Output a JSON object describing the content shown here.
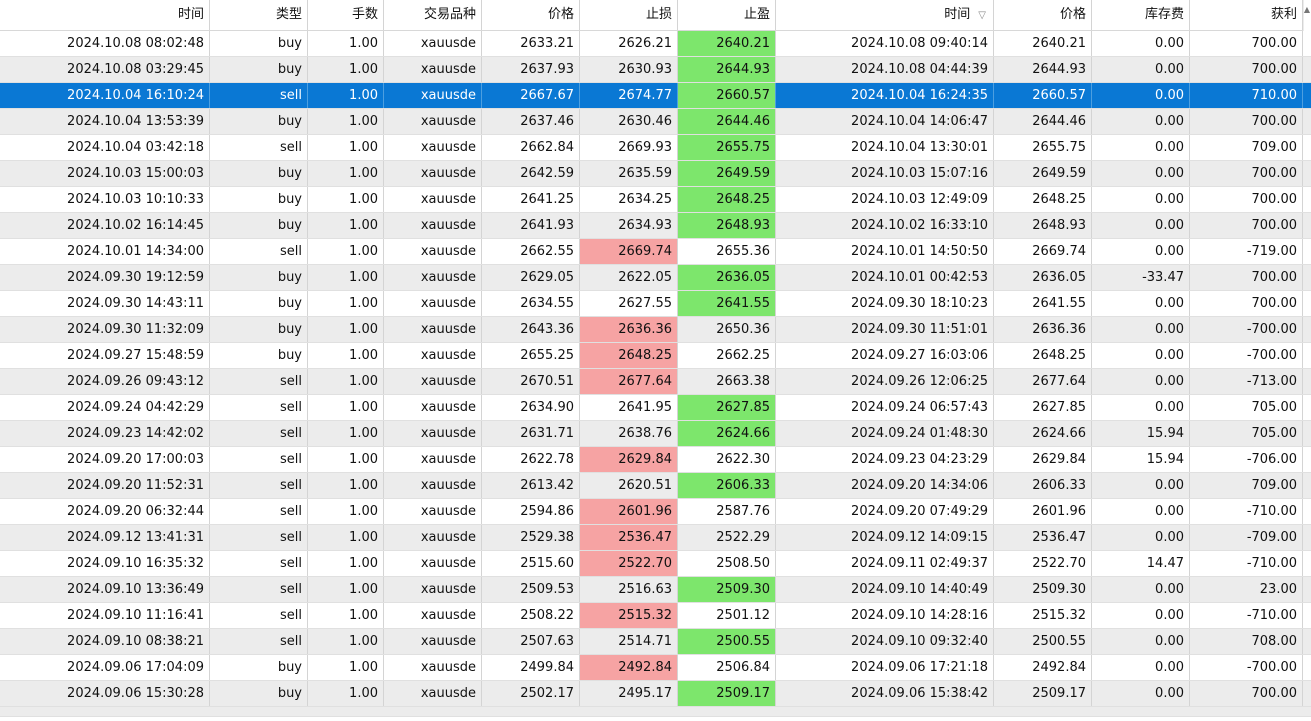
{
  "columns": [
    {
      "label": "时间"
    },
    {
      "label": "类型"
    },
    {
      "label": "手数"
    },
    {
      "label": "交易品种"
    },
    {
      "label": "价格"
    },
    {
      "label": "止损"
    },
    {
      "label": "止盈"
    },
    {
      "label": "时间",
      "sort_icon": "sort-descending-icon",
      "sort_glyph": "▽"
    },
    {
      "label": "价格"
    },
    {
      "label": "库存费"
    },
    {
      "label": "获利"
    }
  ],
  "colors": {
    "selected": "#0a78d4",
    "take_profit_hit": "#7de66c",
    "stop_loss_hit": "#f6a3a3",
    "alt_row": "#ececec"
  },
  "rows": [
    {
      "open_time": "2024.10.08 08:02:48",
      "type": "buy",
      "volume": "1.00",
      "symbol": "xauusde",
      "open_price": "2633.21",
      "sl": "2626.21",
      "tp": "2640.21",
      "close_time": "2024.10.08 09:40:14",
      "close_price": "2640.21",
      "swap": "0.00",
      "profit": "700.00",
      "hit": "tp"
    },
    {
      "open_time": "2024.10.08 03:29:45",
      "type": "buy",
      "volume": "1.00",
      "symbol": "xauusde",
      "open_price": "2637.93",
      "sl": "2630.93",
      "tp": "2644.93",
      "close_time": "2024.10.08 04:44:39",
      "close_price": "2644.93",
      "swap": "0.00",
      "profit": "700.00",
      "hit": "tp"
    },
    {
      "open_time": "2024.10.04 16:10:24",
      "type": "sell",
      "volume": "1.00",
      "symbol": "xauusde",
      "open_price": "2667.67",
      "sl": "2674.77",
      "tp": "2660.57",
      "close_time": "2024.10.04 16:24:35",
      "close_price": "2660.57",
      "swap": "0.00",
      "profit": "710.00",
      "hit": "tp",
      "selected": true
    },
    {
      "open_time": "2024.10.04 13:53:39",
      "type": "buy",
      "volume": "1.00",
      "symbol": "xauusde",
      "open_price": "2637.46",
      "sl": "2630.46",
      "tp": "2644.46",
      "close_time": "2024.10.04 14:06:47",
      "close_price": "2644.46",
      "swap": "0.00",
      "profit": "700.00",
      "hit": "tp"
    },
    {
      "open_time": "2024.10.04 03:42:18",
      "type": "sell",
      "volume": "1.00",
      "symbol": "xauusde",
      "open_price": "2662.84",
      "sl": "2669.93",
      "tp": "2655.75",
      "close_time": "2024.10.04 13:30:01",
      "close_price": "2655.75",
      "swap": "0.00",
      "profit": "709.00",
      "hit": "tp"
    },
    {
      "open_time": "2024.10.03 15:00:03",
      "type": "buy",
      "volume": "1.00",
      "symbol": "xauusde",
      "open_price": "2642.59",
      "sl": "2635.59",
      "tp": "2649.59",
      "close_time": "2024.10.03 15:07:16",
      "close_price": "2649.59",
      "swap": "0.00",
      "profit": "700.00",
      "hit": "tp"
    },
    {
      "open_time": "2024.10.03 10:10:33",
      "type": "buy",
      "volume": "1.00",
      "symbol": "xauusde",
      "open_price": "2641.25",
      "sl": "2634.25",
      "tp": "2648.25",
      "close_time": "2024.10.03 12:49:09",
      "close_price": "2648.25",
      "swap": "0.00",
      "profit": "700.00",
      "hit": "tp"
    },
    {
      "open_time": "2024.10.02 16:14:45",
      "type": "buy",
      "volume": "1.00",
      "symbol": "xauusde",
      "open_price": "2641.93",
      "sl": "2634.93",
      "tp": "2648.93",
      "close_time": "2024.10.02 16:33:10",
      "close_price": "2648.93",
      "swap": "0.00",
      "profit": "700.00",
      "hit": "tp"
    },
    {
      "open_time": "2024.10.01 14:34:00",
      "type": "sell",
      "volume": "1.00",
      "symbol": "xauusde",
      "open_price": "2662.55",
      "sl": "2669.74",
      "tp": "2655.36",
      "close_time": "2024.10.01 14:50:50",
      "close_price": "2669.74",
      "swap": "0.00",
      "profit": "-719.00",
      "hit": "sl"
    },
    {
      "open_time": "2024.09.30 19:12:59",
      "type": "buy",
      "volume": "1.00",
      "symbol": "xauusde",
      "open_price": "2629.05",
      "sl": "2622.05",
      "tp": "2636.05",
      "close_time": "2024.10.01 00:42:53",
      "close_price": "2636.05",
      "swap": "-33.47",
      "profit": "700.00",
      "hit": "tp"
    },
    {
      "open_time": "2024.09.30 14:43:11",
      "type": "buy",
      "volume": "1.00",
      "symbol": "xauusde",
      "open_price": "2634.55",
      "sl": "2627.55",
      "tp": "2641.55",
      "close_time": "2024.09.30 18:10:23",
      "close_price": "2641.55",
      "swap": "0.00",
      "profit": "700.00",
      "hit": "tp"
    },
    {
      "open_time": "2024.09.30 11:32:09",
      "type": "buy",
      "volume": "1.00",
      "symbol": "xauusde",
      "open_price": "2643.36",
      "sl": "2636.36",
      "tp": "2650.36",
      "close_time": "2024.09.30 11:51:01",
      "close_price": "2636.36",
      "swap": "0.00",
      "profit": "-700.00",
      "hit": "sl"
    },
    {
      "open_time": "2024.09.27 15:48:59",
      "type": "buy",
      "volume": "1.00",
      "symbol": "xauusde",
      "open_price": "2655.25",
      "sl": "2648.25",
      "tp": "2662.25",
      "close_time": "2024.09.27 16:03:06",
      "close_price": "2648.25",
      "swap": "0.00",
      "profit": "-700.00",
      "hit": "sl"
    },
    {
      "open_time": "2024.09.26 09:43:12",
      "type": "sell",
      "volume": "1.00",
      "symbol": "xauusde",
      "open_price": "2670.51",
      "sl": "2677.64",
      "tp": "2663.38",
      "close_time": "2024.09.26 12:06:25",
      "close_price": "2677.64",
      "swap": "0.00",
      "profit": "-713.00",
      "hit": "sl"
    },
    {
      "open_time": "2024.09.24 04:42:29",
      "type": "sell",
      "volume": "1.00",
      "symbol": "xauusde",
      "open_price": "2634.90",
      "sl": "2641.95",
      "tp": "2627.85",
      "close_time": "2024.09.24 06:57:43",
      "close_price": "2627.85",
      "swap": "0.00",
      "profit": "705.00",
      "hit": "tp"
    },
    {
      "open_time": "2024.09.23 14:42:02",
      "type": "sell",
      "volume": "1.00",
      "symbol": "xauusde",
      "open_price": "2631.71",
      "sl": "2638.76",
      "tp": "2624.66",
      "close_time": "2024.09.24 01:48:30",
      "close_price": "2624.66",
      "swap": "15.94",
      "profit": "705.00",
      "hit": "tp"
    },
    {
      "open_time": "2024.09.20 17:00:03",
      "type": "sell",
      "volume": "1.00",
      "symbol": "xauusde",
      "open_price": "2622.78",
      "sl": "2629.84",
      "tp": "2622.30",
      "close_time": "2024.09.23 04:23:29",
      "close_price": "2629.84",
      "swap": "15.94",
      "profit": "-706.00",
      "hit": "sl"
    },
    {
      "open_time": "2024.09.20 11:52:31",
      "type": "sell",
      "volume": "1.00",
      "symbol": "xauusde",
      "open_price": "2613.42",
      "sl": "2620.51",
      "tp": "2606.33",
      "close_time": "2024.09.20 14:34:06",
      "close_price": "2606.33",
      "swap": "0.00",
      "profit": "709.00",
      "hit": "tp"
    },
    {
      "open_time": "2024.09.20 06:32:44",
      "type": "sell",
      "volume": "1.00",
      "symbol": "xauusde",
      "open_price": "2594.86",
      "sl": "2601.96",
      "tp": "2587.76",
      "close_time": "2024.09.20 07:49:29",
      "close_price": "2601.96",
      "swap": "0.00",
      "profit": "-710.00",
      "hit": "sl"
    },
    {
      "open_time": "2024.09.12 13:41:31",
      "type": "sell",
      "volume": "1.00",
      "symbol": "xauusde",
      "open_price": "2529.38",
      "sl": "2536.47",
      "tp": "2522.29",
      "close_time": "2024.09.12 14:09:15",
      "close_price": "2536.47",
      "swap": "0.00",
      "profit": "-709.00",
      "hit": "sl"
    },
    {
      "open_time": "2024.09.10 16:35:32",
      "type": "sell",
      "volume": "1.00",
      "symbol": "xauusde",
      "open_price": "2515.60",
      "sl": "2522.70",
      "tp": "2508.50",
      "close_time": "2024.09.11 02:49:37",
      "close_price": "2522.70",
      "swap": "14.47",
      "profit": "-710.00",
      "hit": "sl"
    },
    {
      "open_time": "2024.09.10 13:36:49",
      "type": "sell",
      "volume": "1.00",
      "symbol": "xauusde",
      "open_price": "2509.53",
      "sl": "2516.63",
      "tp": "2509.30",
      "close_time": "2024.09.10 14:40:49",
      "close_price": "2509.30",
      "swap": "0.00",
      "profit": "23.00",
      "hit": "tp"
    },
    {
      "open_time": "2024.09.10 11:16:41",
      "type": "sell",
      "volume": "1.00",
      "symbol": "xauusde",
      "open_price": "2508.22",
      "sl": "2515.32",
      "tp": "2501.12",
      "close_time": "2024.09.10 14:28:16",
      "close_price": "2515.32",
      "swap": "0.00",
      "profit": "-710.00",
      "hit": "sl"
    },
    {
      "open_time": "2024.09.10 08:38:21",
      "type": "sell",
      "volume": "1.00",
      "symbol": "xauusde",
      "open_price": "2507.63",
      "sl": "2514.71",
      "tp": "2500.55",
      "close_time": "2024.09.10 09:32:40",
      "close_price": "2500.55",
      "swap": "0.00",
      "profit": "708.00",
      "hit": "tp"
    },
    {
      "open_time": "2024.09.06 17:04:09",
      "type": "buy",
      "volume": "1.00",
      "symbol": "xauusde",
      "open_price": "2499.84",
      "sl": "2492.84",
      "tp": "2506.84",
      "close_time": "2024.09.06 17:21:18",
      "close_price": "2492.84",
      "swap": "0.00",
      "profit": "-700.00",
      "hit": "sl"
    },
    {
      "open_time": "2024.09.06 15:30:28",
      "type": "buy",
      "volume": "1.00",
      "symbol": "xauusde",
      "open_price": "2502.17",
      "sl": "2495.17",
      "tp": "2509.17",
      "close_time": "2024.09.06 15:38:42",
      "close_price": "2509.17",
      "swap": "0.00",
      "profit": "700.00",
      "hit": "tp"
    }
  ]
}
